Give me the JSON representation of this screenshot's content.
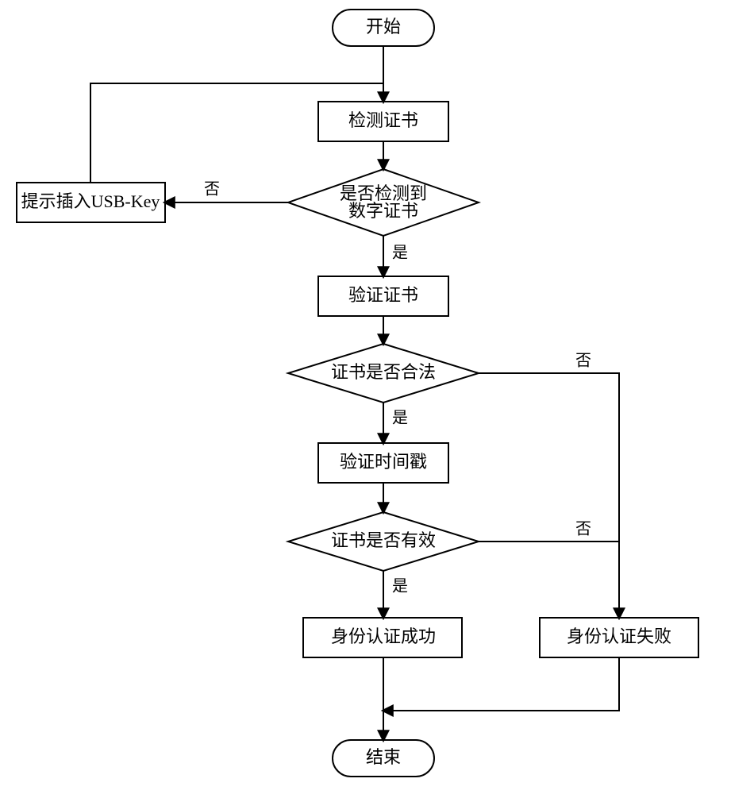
{
  "nodes": {
    "start": "开始",
    "detect_cert": "检测证书",
    "prompt_usb": "提示插入USB-Key",
    "check_detected_l1": "是否检测到",
    "check_detected_l2": "数字证书",
    "verify_cert": "验证证书",
    "cert_legal": "证书是否合法",
    "verify_timestamp": "验证时间戳",
    "cert_valid": "证书是否有效",
    "auth_success": "身份认证成功",
    "auth_fail": "身份认证失败",
    "end": "结束"
  },
  "labels": {
    "yes": "是",
    "no": "否"
  }
}
